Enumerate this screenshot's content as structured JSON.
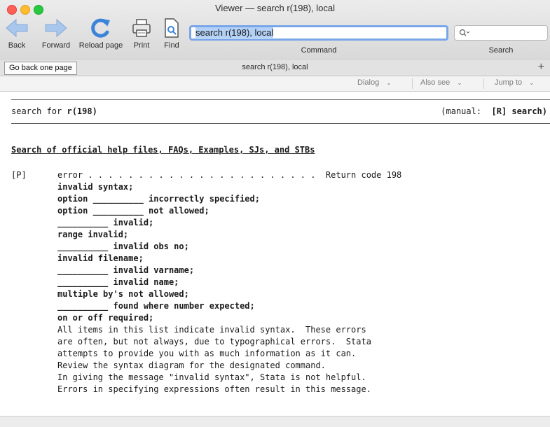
{
  "window": {
    "title": "Viewer — search r(198), local"
  },
  "toolbar": {
    "back_label": "Back",
    "forward_label": "Forward",
    "reload_label": "Reload page",
    "print_label": "Print",
    "find_label": "Find",
    "command_value": "search r(198), local",
    "command_label": "Command",
    "search_label": "Search",
    "search_icon": "magnifier-dropdown-icon"
  },
  "tabbar": {
    "tooltip": "Go back one page",
    "tab_title": "search r(198), local"
  },
  "dropdowns": [
    "Dialog",
    "Also see",
    "Jump to"
  ],
  "content": {
    "header_left_prefix": "search for ",
    "header_left_term": "r(198)",
    "header_right_prefix": "(manual:  ",
    "header_right_ref": "[R] search)",
    "section_heading": "Search of official help files, FAQs, Examples, SJs, and STBs",
    "tag": "[P]",
    "error_line": "error . . . . . . . . . . . . . . . . . . . . . . .  Return code 198",
    "bold_lines": [
      "invalid syntax;",
      "option __________ incorrectly specified;",
      "option __________ not allowed;",
      "__________ invalid;",
      "range invalid;",
      "__________ invalid obs no;",
      "invalid filename;",
      "__________ invalid varname;",
      "__________ invalid name;",
      "multiple by's not allowed;",
      "__________ found where number expected;",
      "on or off required;"
    ],
    "description_lines": [
      "All items in this list indicate invalid syntax.  These errors",
      "are often, but not always, due to typographical errors.  Stata",
      "attempts to provide you with as much information as it can.",
      "Review the syntax diagram for the designated command.",
      "In giving the message \"invalid syntax\", Stata is not helpful.",
      "Errors in specifying expressions often result in this message."
    ]
  },
  "colors": {
    "accent": "#79a6e8",
    "arrow": "#9cbce6",
    "reload": "#3c84d9"
  }
}
